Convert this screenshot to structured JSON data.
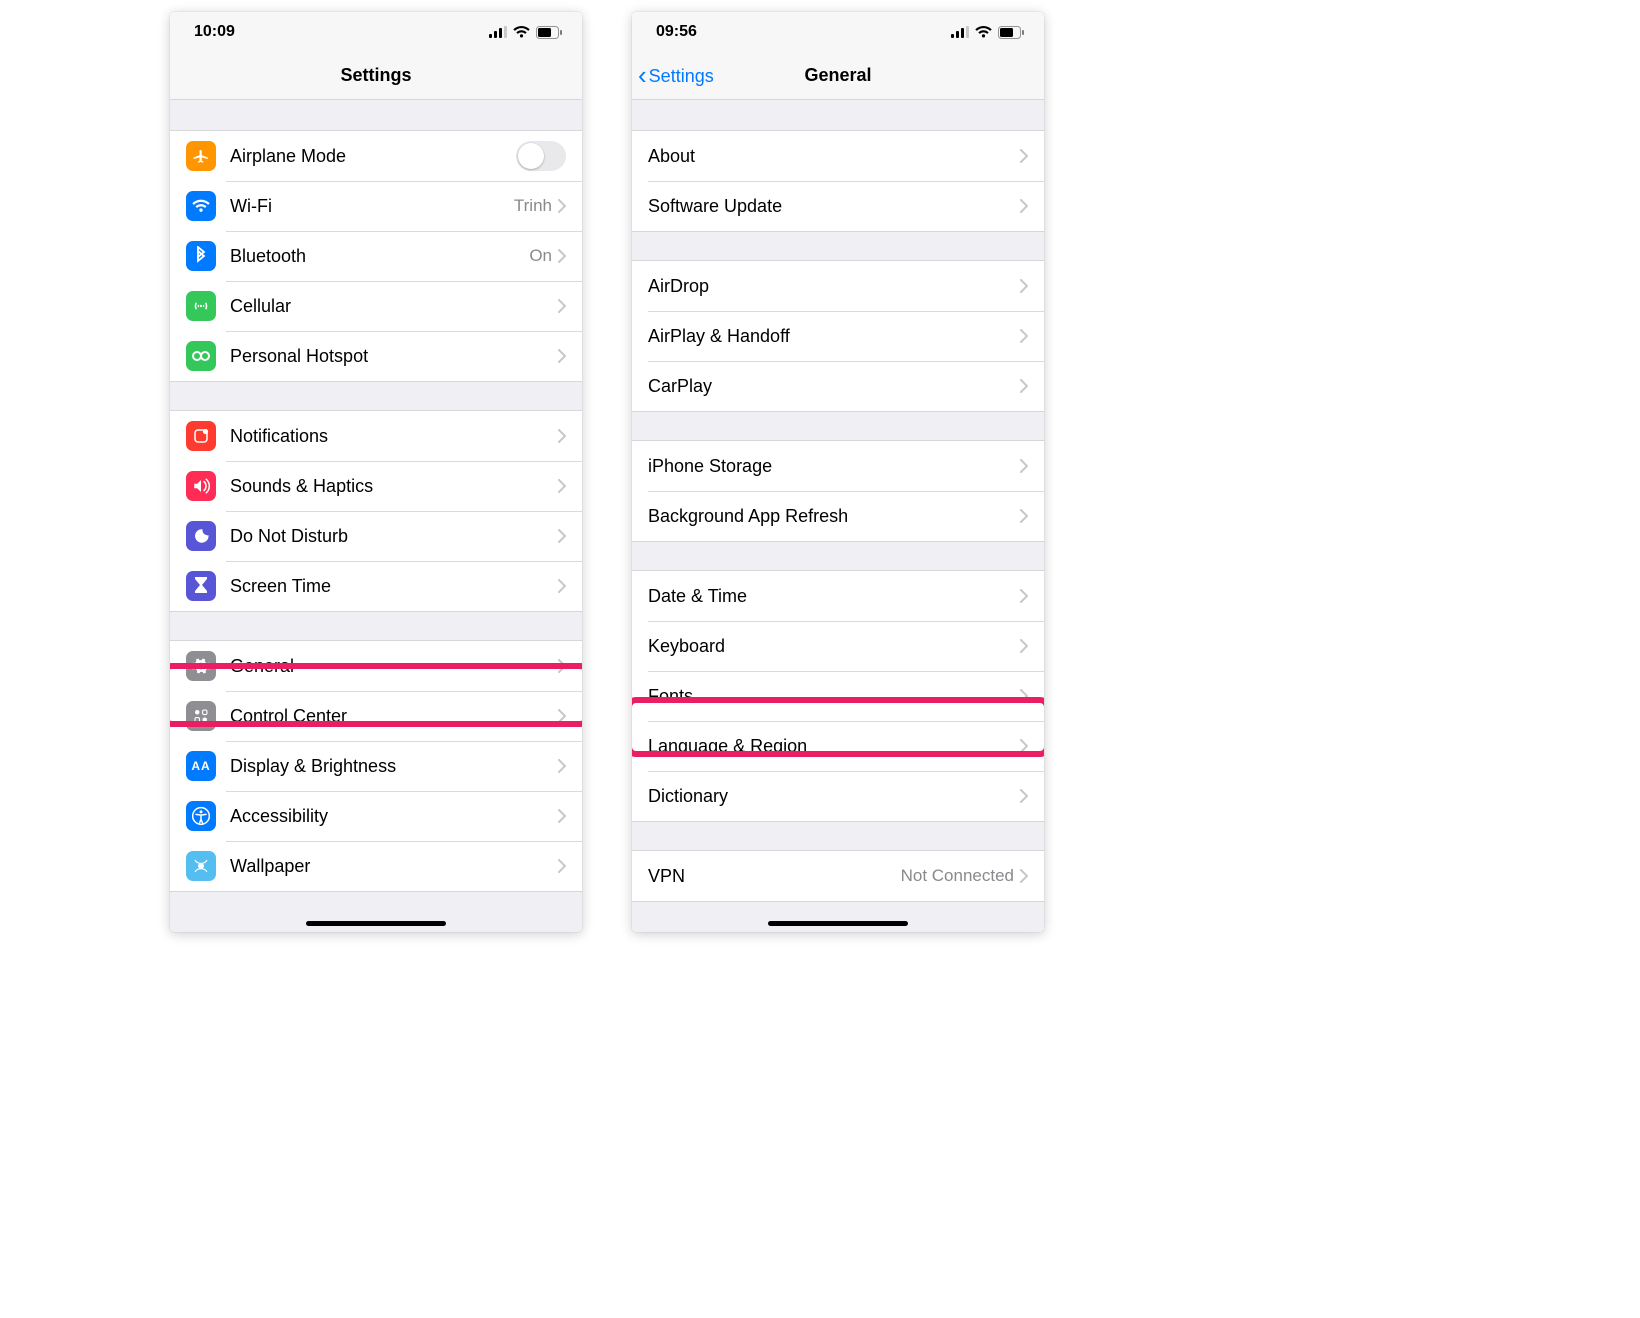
{
  "left": {
    "status_time": "10:09",
    "nav_title": "Settings",
    "groups": [
      [
        {
          "id": "airplane",
          "label": "Airplane Mode",
          "toggle": true
        },
        {
          "id": "wifi",
          "label": "Wi-Fi",
          "value": "Trinh",
          "chevron": true
        },
        {
          "id": "bluetooth",
          "label": "Bluetooth",
          "value": "On",
          "chevron": true
        },
        {
          "id": "cellular",
          "label": "Cellular",
          "chevron": true
        },
        {
          "id": "hotspot",
          "label": "Personal Hotspot",
          "chevron": true
        }
      ],
      [
        {
          "id": "notifications",
          "label": "Notifications",
          "chevron": true
        },
        {
          "id": "sounds",
          "label": "Sounds & Haptics",
          "chevron": true
        },
        {
          "id": "dnd",
          "label": "Do Not Disturb",
          "chevron": true
        },
        {
          "id": "screentime",
          "label": "Screen Time",
          "chevron": true
        }
      ],
      [
        {
          "id": "general",
          "label": "General",
          "chevron": true,
          "highlighted": true
        },
        {
          "id": "control",
          "label": "Control Center",
          "chevron": true
        },
        {
          "id": "display",
          "label": "Display & Brightness",
          "chevron": true
        },
        {
          "id": "access",
          "label": "Accessibility",
          "chevron": true
        },
        {
          "id": "wallpaper",
          "label": "Wallpaper",
          "chevron": true
        }
      ]
    ]
  },
  "right": {
    "status_time": "09:56",
    "nav_back": "Settings",
    "nav_title": "General",
    "groups": [
      [
        {
          "id": "about",
          "label": "About",
          "chevron": true
        },
        {
          "id": "swupdate",
          "label": "Software Update",
          "chevron": true
        }
      ],
      [
        {
          "id": "airdrop",
          "label": "AirDrop",
          "chevron": true
        },
        {
          "id": "airplay",
          "label": "AirPlay & Handoff",
          "chevron": true
        },
        {
          "id": "carplay",
          "label": "CarPlay",
          "chevron": true
        }
      ],
      [
        {
          "id": "storage",
          "label": "iPhone Storage",
          "chevron": true
        },
        {
          "id": "bgapp",
          "label": "Background App Refresh",
          "chevron": true
        }
      ],
      [
        {
          "id": "datetime",
          "label": "Date & Time",
          "chevron": true
        },
        {
          "id": "keyboard",
          "label": "Keyboard",
          "chevron": true
        },
        {
          "id": "fonts",
          "label": "Fonts",
          "chevron": true,
          "highlighted": true
        },
        {
          "id": "langregion",
          "label": "Language & Region",
          "chevron": true
        },
        {
          "id": "dictionary",
          "label": "Dictionary",
          "chevron": true
        }
      ],
      [
        {
          "id": "vpn",
          "label": "VPN",
          "value": "Not Connected",
          "chevron": true
        }
      ]
    ]
  }
}
